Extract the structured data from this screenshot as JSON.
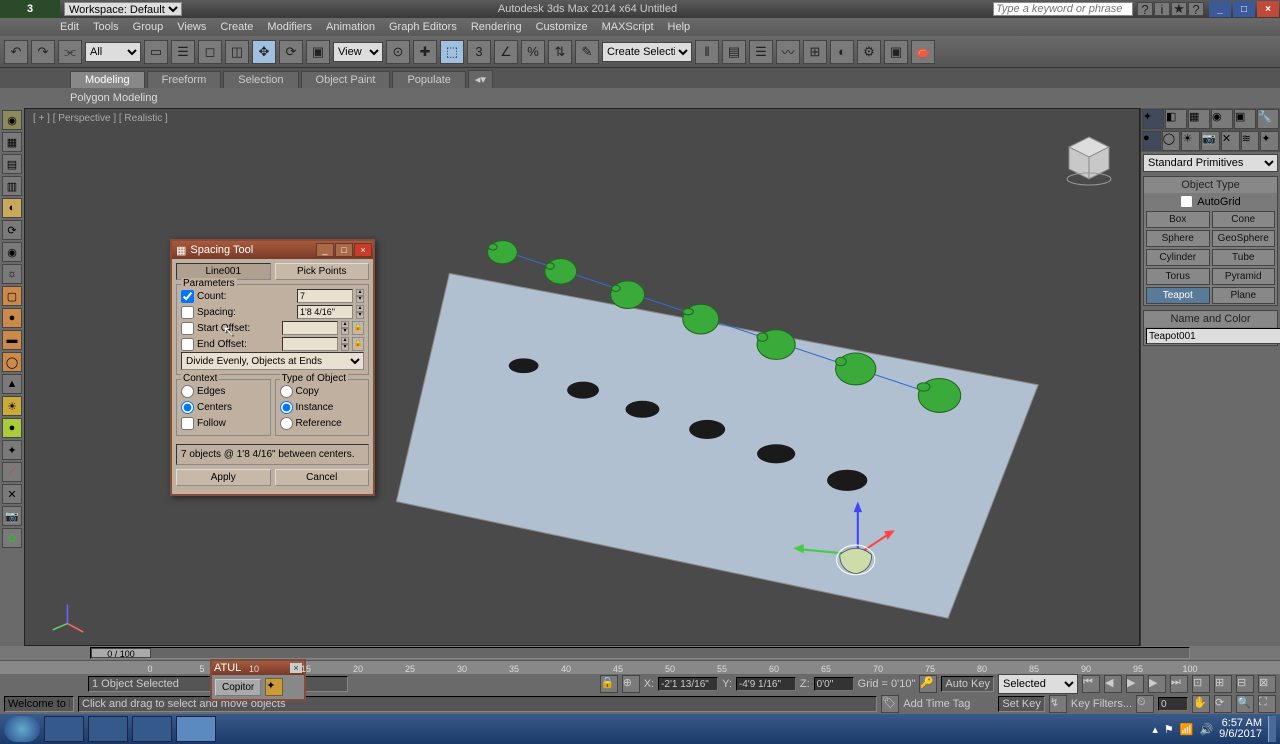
{
  "title": "Autodesk 3ds Max 2014 x64     Untitled",
  "workspace_label": "Workspace: Default",
  "search_placeholder": "Type a keyword or phrase",
  "menus": [
    "Edit",
    "Tools",
    "Group",
    "Views",
    "Create",
    "Modifiers",
    "Animation",
    "Graph Editors",
    "Rendering",
    "Customize",
    "MAXScript",
    "Help"
  ],
  "toolbar_all": "All",
  "toolbar_view": "View",
  "create_set": "Create Selection Se",
  "tabs": [
    "Modeling",
    "Freeform",
    "Selection",
    "Object Paint",
    "Populate"
  ],
  "ribbon_label": "Polygon Modeling",
  "vp_label": "[ + ] [ Perspective ] [ Realistic ]",
  "dialog": {
    "title": "Spacing Tool",
    "pick_path": "Line001",
    "pick_points": "Pick Points",
    "params_label": "Parameters",
    "count_label": "Count:",
    "count_val": "7",
    "spacing_label": "Spacing:",
    "spacing_val": "1'8 4/16\"",
    "start_label": "Start Offset:",
    "start_val": "",
    "end_label": "End Offset:",
    "end_val": "",
    "mode": "Divide Evenly, Objects at Ends",
    "context_label": "Context",
    "edges": "Edges",
    "centers": "Centers",
    "follow": "Follow",
    "type_label": "Type of Object",
    "copy": "Copy",
    "instance": "Instance",
    "reference": "Reference",
    "status": "7 objects @ 1'8 4/16\" between centers.",
    "apply": "Apply",
    "cancel": "Cancel"
  },
  "floater": {
    "title": "ATUL",
    "btn": "Copitor"
  },
  "right": {
    "primitive_dd": "Standard Primitives",
    "objtype": "Object Type",
    "autogrid": "AutoGrid",
    "rows": [
      [
        "Box",
        "Cone"
      ],
      [
        "Sphere",
        "GeoSphere"
      ],
      [
        "Cylinder",
        "Tube"
      ],
      [
        "Torus",
        "Pyramid"
      ],
      [
        "Teapot",
        "Plane"
      ]
    ],
    "namecolor": "Name and Color",
    "objname": "Teapot001"
  },
  "slider_text": "0 / 100",
  "statusbar": {
    "selected": "1 Object Selected",
    "x": "-2'1 13/16\"",
    "y": "-4'9 1/16\"",
    "z": "0'0\"",
    "grid": "Grid = 0'10\"",
    "autokey": "Auto Key",
    "setkey": "Set Key",
    "selmode": "Selected",
    "keyfilters": "Key Filters...",
    "spin": "0"
  },
  "prompt": {
    "welcome": "Welcome to MA",
    "hint": "Click and drag to select and move objects",
    "addtag": "Add Time Tag"
  },
  "clock": {
    "time": "6:57 AM",
    "date": "9/6/2017"
  }
}
